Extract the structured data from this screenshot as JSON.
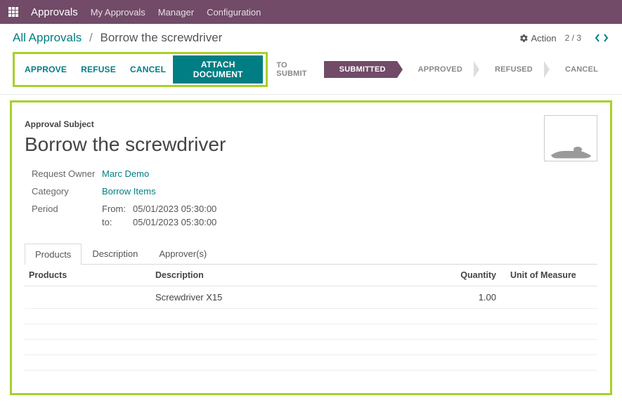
{
  "topbar": {
    "brand": "Approvals",
    "items": [
      "My Approvals",
      "Manager",
      "Configuration"
    ]
  },
  "breadcrumb": {
    "root": "All Approvals",
    "current": "Borrow the screwdriver"
  },
  "action": {
    "label": "Action"
  },
  "pager": {
    "position": "2 / 3"
  },
  "toolbar": {
    "approve": "APPROVE",
    "refuse": "REFUSE",
    "cancel": "CANCEL",
    "attach": "ATTACH DOCUMENT"
  },
  "status": {
    "steps": [
      "TO SUBMIT",
      "SUBMITTED",
      "APPROVED",
      "REFUSED",
      "CANCEL"
    ],
    "active_index": 1
  },
  "form": {
    "subject_label": "Approval Subject",
    "subject": "Borrow the screwdriver",
    "owner_label": "Request Owner",
    "owner": "Marc Demo",
    "category_label": "Category",
    "category": "Borrow Items",
    "period_label": "Period",
    "period_from_label": "From:",
    "period_from": "05/01/2023 05:30:00",
    "period_to_label": "to:",
    "period_to": "05/01/2023 05:30:00"
  },
  "tabs": {
    "t0": "Products",
    "t1": "Description",
    "t2": "Approver(s)",
    "active": 0
  },
  "table": {
    "h_products": "Products",
    "h_desc": "Description",
    "h_qty": "Quantity",
    "h_uom": "Unit of Measure",
    "rows": [
      {
        "product": "",
        "desc": "Screwdriver X15",
        "qty": "1.00",
        "uom": ""
      }
    ]
  }
}
